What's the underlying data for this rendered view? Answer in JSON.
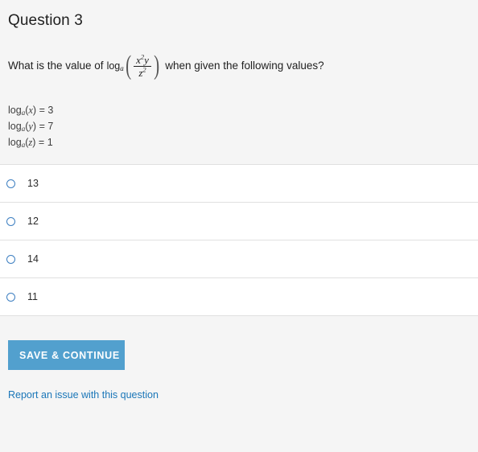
{
  "question": {
    "title": "Question 3",
    "prompt_prefix": "What is the value of",
    "prompt_suffix": "when given the following values?",
    "formula": {
      "function_name": "log",
      "base": "a",
      "numerator_var1": "x",
      "numerator_exp1": "2",
      "numerator_var2": "y",
      "denominator_var": "z",
      "denominator_exp": "2",
      "open_paren": "(",
      "close_paren": ")"
    },
    "given_values": [
      {
        "function_name": "log",
        "base": "a",
        "open": "(",
        "variable": "x",
        "close": ")",
        "equals": "=",
        "value": "3"
      },
      {
        "function_name": "log",
        "base": "a",
        "open": "(",
        "variable": "y",
        "close": ")",
        "equals": "=",
        "value": "7"
      },
      {
        "function_name": "log",
        "base": "a",
        "open": "(",
        "variable": "z",
        "close": ")",
        "equals": "=",
        "value": "1"
      }
    ]
  },
  "options": [
    {
      "label": "13",
      "selected": false
    },
    {
      "label": "12",
      "selected": false
    },
    {
      "label": "14",
      "selected": false
    },
    {
      "label": "11",
      "selected": false
    }
  ],
  "footer": {
    "save_label": "SAVE & CONTINUE",
    "report_link_label": "Report an issue with this question"
  },
  "colors": {
    "page_background": "#f5f5f5",
    "option_background": "#ffffff",
    "divider": "#e0e0e0",
    "button_background": "#52a0ce",
    "button_text": "#ffffff",
    "link": "#1a76b8",
    "radio_border": "#3d7fc1",
    "text": "#1f1f1f"
  }
}
